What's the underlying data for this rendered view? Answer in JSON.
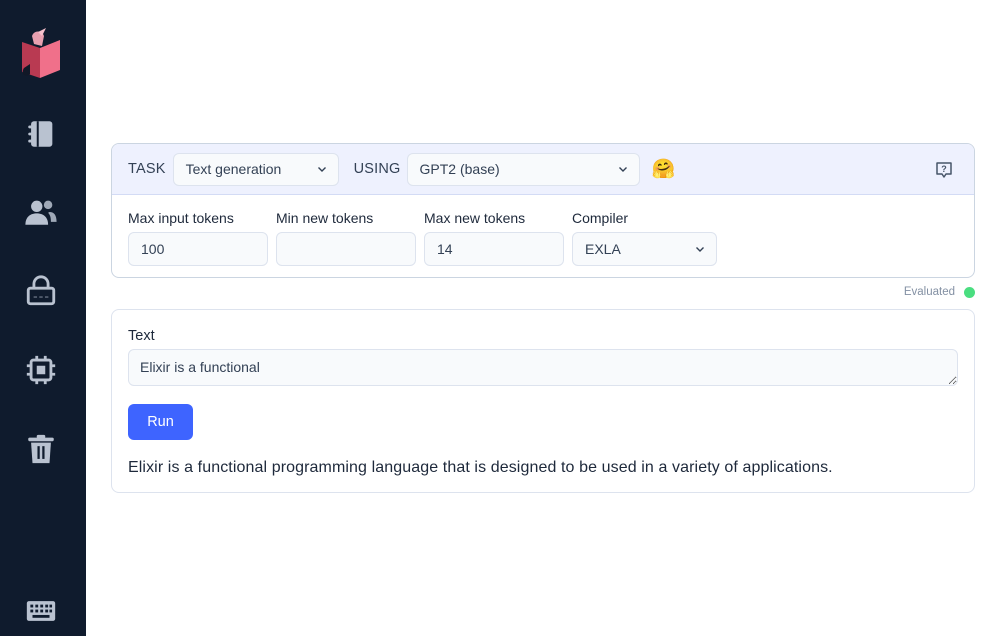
{
  "sidebar": {
    "icons": [
      "livebook-logo",
      "notebook-icon",
      "users-icon",
      "lock-icon",
      "cpu-chip-icon",
      "trash-icon",
      "keyboard-icon"
    ]
  },
  "smart_cell": {
    "task_label": "TASK",
    "task_value": "Text generation",
    "using_label": "USING",
    "using_value": "GPT2 (base)",
    "provider_icon": "hugging-face-emoji",
    "hug_emoji": "🤗",
    "fields": {
      "max_input_tokens": {
        "label": "Max input tokens",
        "value": "100"
      },
      "min_new_tokens": {
        "label": "Min new tokens",
        "value": ""
      },
      "max_new_tokens": {
        "label": "Max new tokens",
        "value": "14"
      },
      "compiler": {
        "label": "Compiler",
        "value": "EXLA"
      }
    }
  },
  "status": {
    "text": "Evaluated",
    "color": "#4ade80"
  },
  "output": {
    "text_label": "Text",
    "text_value": "Elixir is a functional",
    "run_label": "Run",
    "result": "Elixir is a functional programming language that is designed to be used in a variety of applications."
  },
  "colors": {
    "sidebar": "#0f1b2d",
    "accent": "#3e64ff",
    "header_bg": "#eef1fe"
  }
}
